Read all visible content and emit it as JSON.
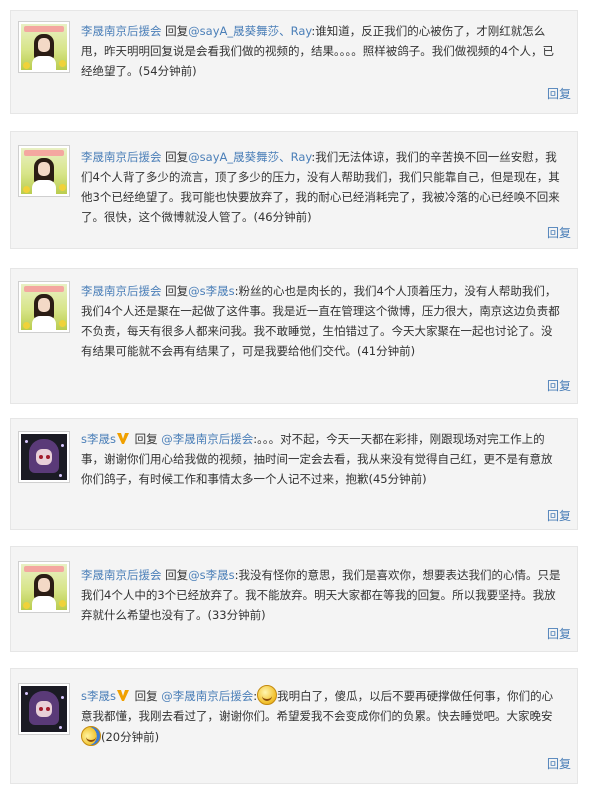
{
  "reply_label": "回复",
  "comments": [
    {
      "author": "李晟南京后援会",
      "verb": "回复",
      "mention": "@sayA_晟葵舞莎、Ray",
      "colon": ":",
      "body": "谁知道，反正我们的心被伤了，才刚红就怎么甩，昨天明明回复说是会看我们做的视频的，结果。。。。照样被鸽子。我们做视频的4个人，已经绝望了。",
      "time": "(54分钟前)"
    },
    {
      "author": "李晟南京后援会",
      "verb": "回复",
      "mention": "@sayA_晟葵舞莎、Ray",
      "colon": ":",
      "body": "我们无法体谅，我们的辛苦换不回一丝安慰，我们4个人背了多少的流言，顶了多少的压力，没有人帮助我们，我们只能靠自己，但是现在，其他3个已经绝望了。我可能也快要放弃了，我的耐心已经消耗完了，我被冷落的心已经唤不回来了。很快，这个微博就没人管了。",
      "time": "(46分钟前)"
    },
    {
      "author": "李晟南京后援会",
      "verb": "回复",
      "mention": "@s李晟s",
      "colon": ":",
      "body": "粉丝的心也是肉长的，我们4个人顶着压力，没有人帮助我们，我们4个人还是聚在一起做了这件事。我是近一直在管理这个微博，压力很大，南京这边负责都不负责，每天有很多人都来问我。我不敢睡觉，生怕错过了。今天大家聚在一起也讨论了。没有结果可能就不会再有结果了，可是我要给他们交代。",
      "time": "(41分钟前)"
    },
    {
      "author": "s李晟s",
      "verb": "回复",
      "mention": "@李晟南京后援会",
      "colon": ":",
      "body": "。。。对不起，今天一天都在彩排，刚跟现场对完工作上的事，谢谢你们用心给我做的视频，抽时间一定会去看，我从来没有觉得自己红，更不是有意放你们鸽子，有时候工作和事情太多一个人记不过来，抱歉",
      "time": "(45分钟前)"
    },
    {
      "author": "李晟南京后援会",
      "verb": "回复",
      "mention": "@s李晟s",
      "colon": ":",
      "body": "我没有怪你的意思，我们是喜欢你，想要表达我们的心情。只是我们4个人中的3个已经放弃了。我不能放弃。明天大家都在等我的回复。所以我要坚持。我放弃就什么希望也没有了。",
      "time": "(33分钟前)"
    },
    {
      "author": "s李晟s",
      "verb": "回复",
      "mention": "@李晟南京后援会",
      "colon": ":",
      "body": "我明白了，傻瓜，以后不要再硬撑做任何事，你们的心意我都懂，我刚去看过了，谢谢你们。希望爱我不会变成你们的负累。快去睡觉吧。大家晚安",
      "time": "(20分钟前)"
    }
  ],
  "colors": {
    "link": "#4b7fb8",
    "card_bg": "#f4f4f4",
    "card_border": "#e6e6e6",
    "vip": "#f0a000"
  },
  "icons": {
    "vip": "vip-v-icon",
    "smile": "smile-emoji-icon",
    "goodnight": "goodnight-emoji-icon"
  }
}
